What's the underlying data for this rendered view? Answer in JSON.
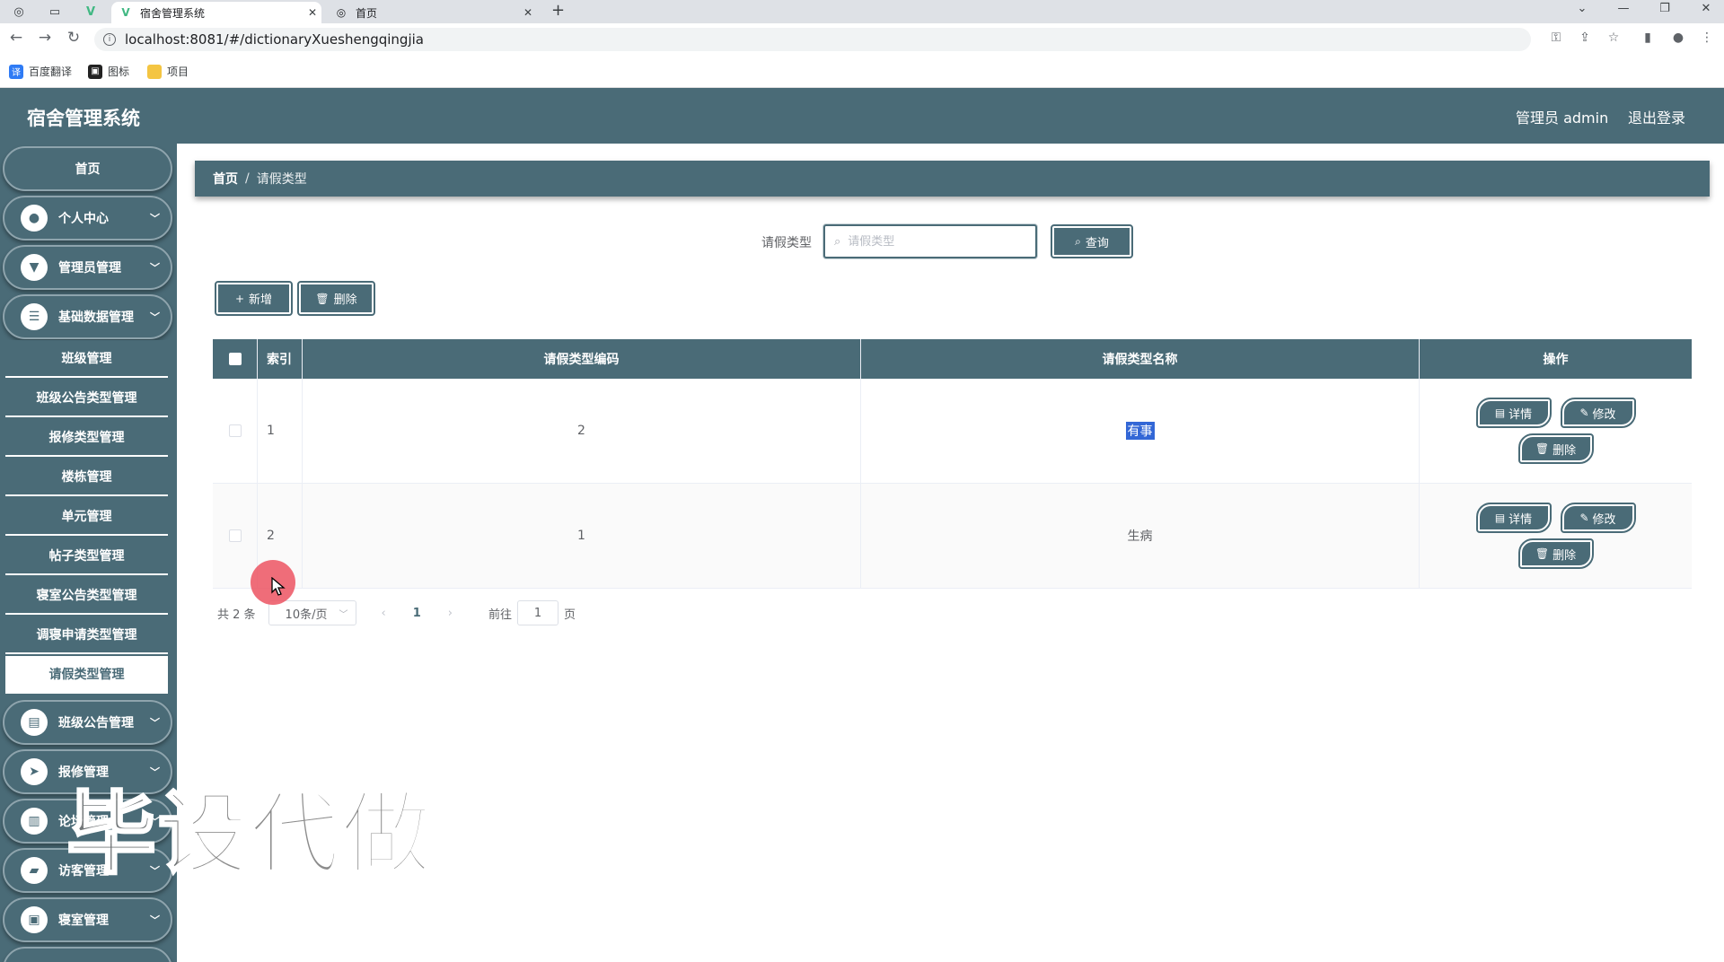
{
  "browser": {
    "tabs": [
      {
        "title": "宿舍管理系统",
        "active": true
      },
      {
        "title": "首页",
        "active": false
      }
    ],
    "url": "localhost:8081/#/dictionaryXueshengqingjia",
    "bookmarks": [
      "百度翻译",
      "图标",
      "项目"
    ]
  },
  "app": {
    "title": "宿舍管理系统",
    "user": "管理员 admin",
    "logout": "退出登录"
  },
  "sidebar": {
    "home": "首页",
    "menus": [
      {
        "label": "个人中心",
        "icon": "user-icon"
      },
      {
        "label": "管理员管理",
        "icon": "admin-icon"
      },
      {
        "label": "基础数据管理",
        "icon": "list-icon"
      }
    ],
    "submenus": [
      "班级管理",
      "班级公告类型管理",
      "报修类型管理",
      "楼栋管理",
      "单元管理",
      "帖子类型管理",
      "寝室公告类型管理",
      "调寝申请类型管理",
      "请假类型管理"
    ],
    "lower_menus": [
      {
        "label": "班级公告管理",
        "icon": "clipboard-icon"
      },
      {
        "label": "报修管理",
        "icon": "send-icon"
      },
      {
        "label": "论坛管理",
        "icon": "book-icon"
      },
      {
        "label": "访客管理",
        "icon": "visitor-icon"
      },
      {
        "label": "寝室管理",
        "icon": "room-icon"
      }
    ]
  },
  "breadcrumb": {
    "home": "首页",
    "separator": "/",
    "current": "请假类型"
  },
  "search": {
    "label": "请假类型",
    "placeholder": "请假类型",
    "button": "查询"
  },
  "actions": {
    "add": "新增",
    "delete": "删除"
  },
  "table": {
    "headers": [
      "索引",
      "请假类型编码",
      "请假类型名称",
      "操作"
    ],
    "rows": [
      {
        "index": "1",
        "code": "2",
        "name": "有事"
      },
      {
        "index": "2",
        "code": "1",
        "name": "生病"
      }
    ],
    "row_actions": {
      "detail": "详情",
      "edit": "修改",
      "delete": "删除"
    }
  },
  "pagination": {
    "total": "共 2 条",
    "page_size": "10条/页",
    "current_page": "1",
    "goto_label": "前往",
    "goto_value": "1",
    "page_unit": "页"
  },
  "watermark": "毕设代做",
  "colors": {
    "primary": "#4a6b77",
    "cursor": "#ec5462",
    "highlight": "#3367d6"
  }
}
